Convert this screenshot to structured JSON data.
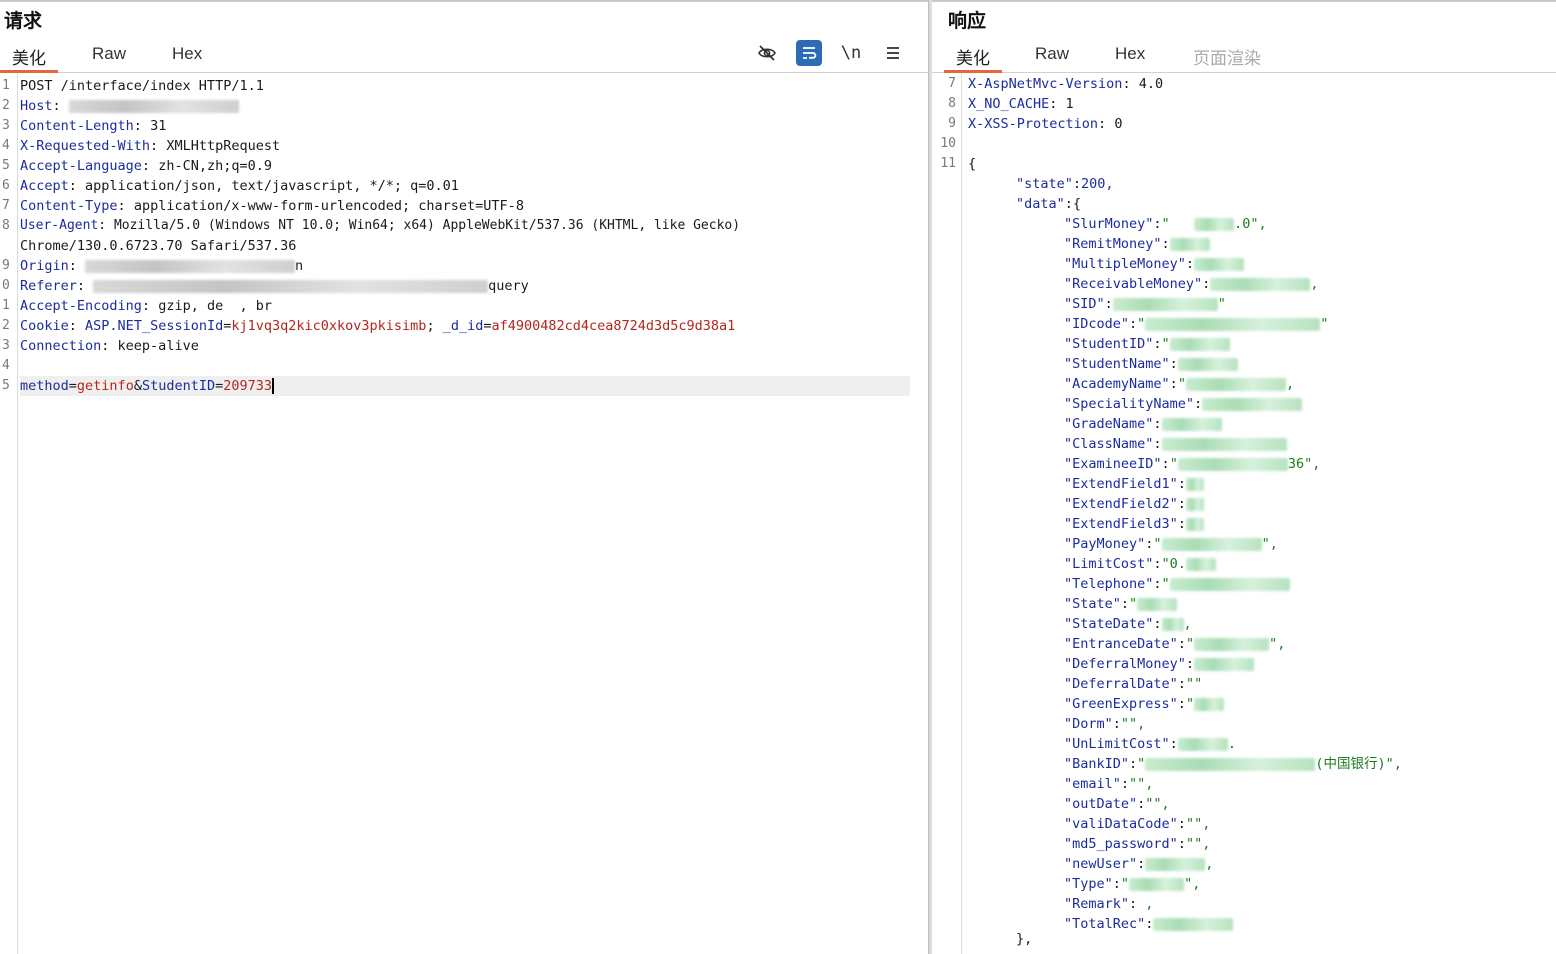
{
  "request": {
    "title": "请求",
    "tabs": [
      "美化",
      "Raw",
      "Hex"
    ],
    "toolbar": [
      "eye-off-icon",
      "wrap-icon",
      "newline-icon",
      "menu-icon"
    ],
    "toolbar_newline_label": "\\n",
    "lines": [
      {
        "n": "1",
        "raw": "POST /interface/index HTTP/1.1"
      },
      {
        "n": "2",
        "key": "Host",
        "sep": ": "
      },
      {
        "n": "3",
        "key": "Content-Length",
        "sep": ": ",
        "val": "31"
      },
      {
        "n": "4",
        "key": "X-Requested-With",
        "sep": ": ",
        "val": "XMLHttpRequest"
      },
      {
        "n": "5",
        "key": "Accept-Language",
        "sep": ": ",
        "val": "zh-CN,zh;q=0.9"
      },
      {
        "n": "6",
        "key": "Accept",
        "sep": ": ",
        "val": "application/json, text/javascript, */*; q=0.01"
      },
      {
        "n": "7",
        "key": "Content-Type",
        "sep": ": ",
        "val": "application/x-www-form-urlencoded; charset=UTF-8"
      },
      {
        "n": "8",
        "key": "User-Agent",
        "sep": ": ",
        "val": "Mozilla/5.0 (Windows NT 10.0; Win64; x64) AppleWebKit/537.36 (KHTML, like Gecko)"
      },
      {
        "n": "",
        "raw": "Chrome/130.0.6723.70 Safari/537.36"
      },
      {
        "n": "9",
        "key": "Origin",
        "sep": ": ",
        "val": "n"
      },
      {
        "n": "0",
        "key": "Referer",
        "sep": ": ",
        "val": "query"
      },
      {
        "n": "1",
        "key": "Accept-Encoding",
        "sep": ": ",
        "val": "gzip, de  , br"
      },
      {
        "n": "2",
        "key": "Cookie",
        "sep": ": ",
        "cookie1k": "ASP.NET_SessionId",
        "cookie1v": "kj1vq3q2kic0xkov3pkisimb",
        "cookie2k": "_d_id",
        "cookie2v": "af4900482cd4cea8724d3d5c9d38a1"
      },
      {
        "n": "3",
        "key": "Connection",
        "sep": ": ",
        "val": "keep-alive"
      },
      {
        "n": "4",
        "raw": ""
      },
      {
        "n": "5",
        "p1k": "method",
        "p1v": "getinfo",
        "amp": "&",
        "p2k": "StudentID",
        "p2v": "209733"
      }
    ]
  },
  "response": {
    "title": "响应",
    "tabs": [
      "美化",
      "Raw",
      "Hex",
      "页面渲染"
    ],
    "headers": [
      {
        "n": "7",
        "key": "X-AspNetMvc-Version",
        "val": "4.0"
      },
      {
        "n": "8",
        "key": "X_NO_CACHE",
        "val": "1"
      },
      {
        "n": "9",
        "key": "X-XSS-Protection",
        "val": "0"
      },
      {
        "n": "10",
        "key": "",
        "val": ""
      },
      {
        "n": "11",
        "key": "",
        "val": "{"
      }
    ],
    "json_state_key": "\"state\"",
    "json_state_val": "200,",
    "json_data_key": "\"data\"",
    "json_data_open": ":{",
    "fields": [
      {
        "k": "\"SlurMoney\"",
        "v": "\"   ",
        "tail": ".0\",",
        "bw": 40
      },
      {
        "k": "\"RemitMoney\"",
        "v": "",
        "tail": "",
        "bw": 40
      },
      {
        "k": "\"MultipleMoney\"",
        "v": "",
        "tail": "",
        "bw": 50
      },
      {
        "k": "\"ReceivableMoney\"",
        "v": "",
        "tail": ",",
        "bw": 100
      },
      {
        "k": "\"SID\"",
        "v": "",
        "tail": "\"",
        "bw": 105
      },
      {
        "k": "\"IDcode\"",
        "v": "\"",
        "tail": "\"",
        "bw": 175
      },
      {
        "k": "\"StudentID\"",
        "v": "\"",
        "tail": "",
        "bw": 60
      },
      {
        "k": "\"StudentName\"",
        "v": "",
        "tail": "",
        "bw": 60
      },
      {
        "k": "\"AcademyName\"",
        "v": "\"",
        "tail": ",",
        "bw": 100
      },
      {
        "k": "\"SpecialityName\"",
        "v": "",
        "tail": "",
        "bw": 100
      },
      {
        "k": "\"GradeName\"",
        "v": "",
        "tail": "",
        "bw": 60
      },
      {
        "k": "\"ClassName\"",
        "v": "",
        "tail": "",
        "bw": 125
      },
      {
        "k": "\"ExamineeID\"",
        "v": "\"",
        "tail": "36\",",
        "bw": 110
      },
      {
        "k": "\"ExtendField1\"",
        "v": "",
        "tail": "",
        "bw": 18
      },
      {
        "k": "\"ExtendField2\"",
        "v": "",
        "tail": "",
        "bw": 18
      },
      {
        "k": "\"ExtendField3\"",
        "v": "",
        "tail": "",
        "bw": 18
      },
      {
        "k": "\"PayMoney\"",
        "v": "\"",
        "tail": "\",",
        "bw": 100
      },
      {
        "k": "\"LimitCost\"",
        "v": "\"0.",
        "tail": "",
        "bw": 30
      },
      {
        "k": "\"Telephone\"",
        "v": "\"",
        "tail": "",
        "bw": 120
      },
      {
        "k": "\"State\"",
        "v": "\"",
        "tail": "",
        "bw": 40
      },
      {
        "k": "\"StateDate\"",
        "v": "",
        "tail": ",",
        "bw": 22
      },
      {
        "k": "\"EntranceDate\"",
        "v": "\"",
        "tail": "\",",
        "bw": 75
      },
      {
        "k": "\"DeferralMoney\"",
        "v": "",
        "tail": "",
        "bw": 60
      },
      {
        "k": "\"DeferralDate\"",
        "v": "\"\"",
        "tail": "",
        "bw": 0
      },
      {
        "k": "\"GreenExpress\"",
        "v": "\"",
        "tail": "",
        "bw": 30
      },
      {
        "k": "\"Dorm\"",
        "v": "\"\",",
        "tail": "",
        "bw": 0
      },
      {
        "k": "\"UnLimitCost\"",
        "v": "",
        "tail": ".",
        "bw": 50
      },
      {
        "k": "\"BankID\"",
        "v": "\"",
        "tail": "(中国银行)\",",
        "bw": 170
      },
      {
        "k": "\"email\"",
        "v": "\"\",",
        "tail": "",
        "bw": 0
      },
      {
        "k": "\"outDate\"",
        "v": "\"\",",
        "tail": "",
        "bw": 0
      },
      {
        "k": "\"valiDataCode\"",
        "v": "\"\",",
        "tail": "",
        "bw": 0
      },
      {
        "k": "\"md5_password\"",
        "v": "\"\",",
        "tail": "",
        "bw": 0
      },
      {
        "k": "\"newUser\"",
        "v": "",
        "tail": ",",
        "bw": 60
      },
      {
        "k": "\"Type\"",
        "v": "\"",
        "tail": "\",",
        "bw": 55
      },
      {
        "k": "\"Remark\"",
        "v": "",
        "tail": " ,",
        "bw": 0
      },
      {
        "k": "\"TotalRec\"",
        "v": "",
        "tail": "",
        "bw": 80
      }
    ],
    "json_close": "},"
  }
}
